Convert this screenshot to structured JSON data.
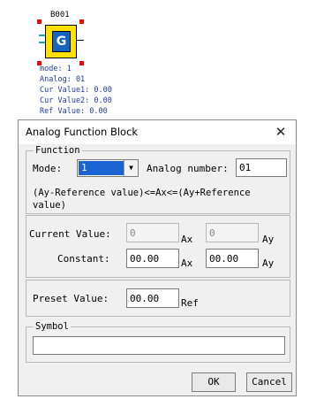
{
  "block": {
    "id": "B001",
    "glyph": "G",
    "params": [
      {
        "label": "mode",
        "value": "1"
      },
      {
        "label": "Analog",
        "value": "01"
      },
      {
        "label": "Cur Value1",
        "value": "0.00"
      },
      {
        "label": "Cur Value2",
        "value": "0.00"
      },
      {
        "label": "Ref Value",
        "value": "0.00"
      }
    ],
    "params_display": [
      "mode: 1",
      "Analog: 01",
      "Cur Value1: 0.00",
      "Cur Value2: 0.00",
      "Ref Value: 0.00"
    ]
  },
  "dialog": {
    "title": "Analog Function Block",
    "close_glyph": "✕",
    "function_group": {
      "legend": "Function",
      "mode_label": "Mode:",
      "mode_value": "1",
      "analog_number_label": "Analog number:",
      "analog_number_value": "01",
      "formula": "(Ay-Reference value)<=Ax<=(Ay+Reference value)"
    },
    "values_group": {
      "current_value_label": "Current Value:",
      "current_ax_value": "0",
      "current_ay_value": "0",
      "constant_label": "Constant:",
      "constant_ax_value": "00.00",
      "constant_ay_value": "00.00",
      "ax_unit": "Ax",
      "ay_unit": "Ay"
    },
    "preset_group": {
      "label": "Preset Value:",
      "value": "00.00",
      "unit": "Ref"
    },
    "symbol_group": {
      "legend": "Symbol",
      "value": ""
    },
    "buttons": {
      "ok": "OK",
      "cancel": "Cancel"
    }
  },
  "colors": {
    "block_yellow": "#ffe000",
    "block_blue": "#1565c0",
    "handle_red": "#e01010",
    "param_text": "#1e3aa8",
    "selection_blue": "#1a64d2"
  }
}
